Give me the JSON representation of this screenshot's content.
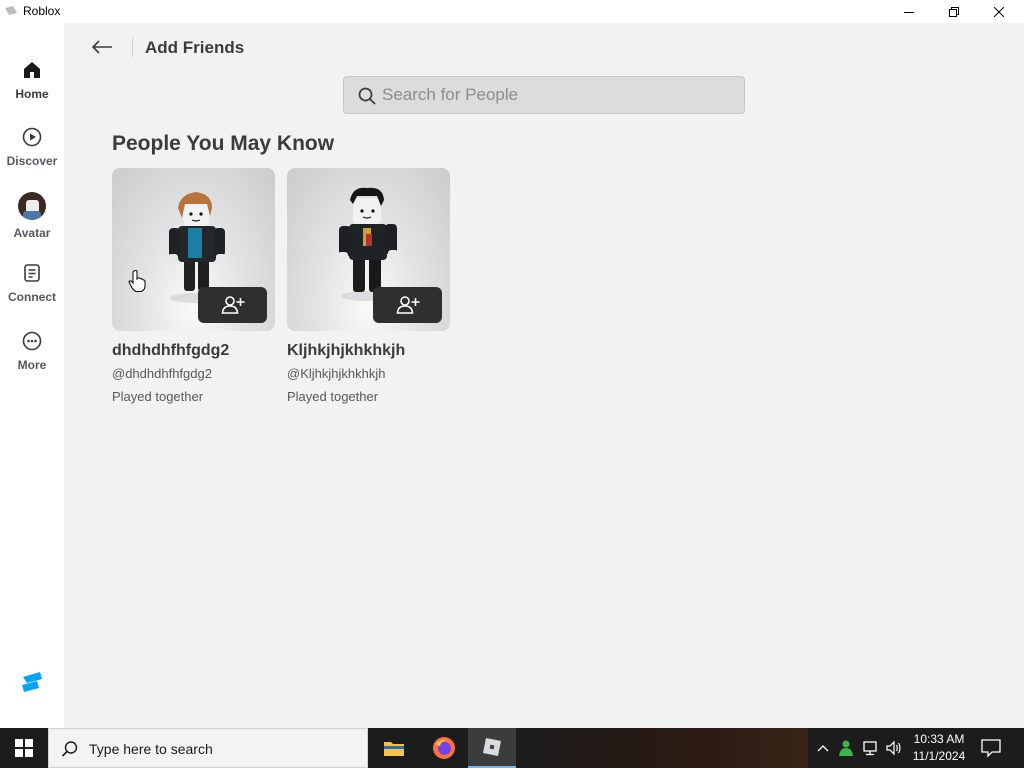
{
  "window": {
    "title": "Roblox"
  },
  "sidebar": {
    "items": [
      {
        "label": "Home",
        "icon": "home-icon",
        "active": true
      },
      {
        "label": "Discover",
        "icon": "play-circle-icon"
      },
      {
        "label": "Avatar",
        "icon": "avatar-icon"
      },
      {
        "label": "Connect",
        "icon": "chat-icon"
      },
      {
        "label": "More",
        "icon": "more-icon"
      }
    ]
  },
  "header": {
    "title": "Add Friends"
  },
  "search": {
    "placeholder": "Search for People",
    "value": ""
  },
  "section": {
    "title": "People You May Know"
  },
  "people": [
    {
      "display_name": "dhdhdhfhfgdg2",
      "username": "@dhdhdhfhfgdg2",
      "status": "Played together"
    },
    {
      "display_name": "Kljhkjhjkhkhkjh",
      "username": "@Kljhkjhjkhkhkjh",
      "status": "Played together"
    }
  ],
  "taskbar": {
    "search_text": "Type here to search",
    "time": "10:33 AM",
    "date": "11/1/2024"
  },
  "colors": {
    "main_bg": "#f2f2f2",
    "sidebar_bg": "#ffffff",
    "button_dark": "#2d2f31",
    "text_primary": "#393b3d",
    "taskbar_bg": "#1c1c1c"
  }
}
